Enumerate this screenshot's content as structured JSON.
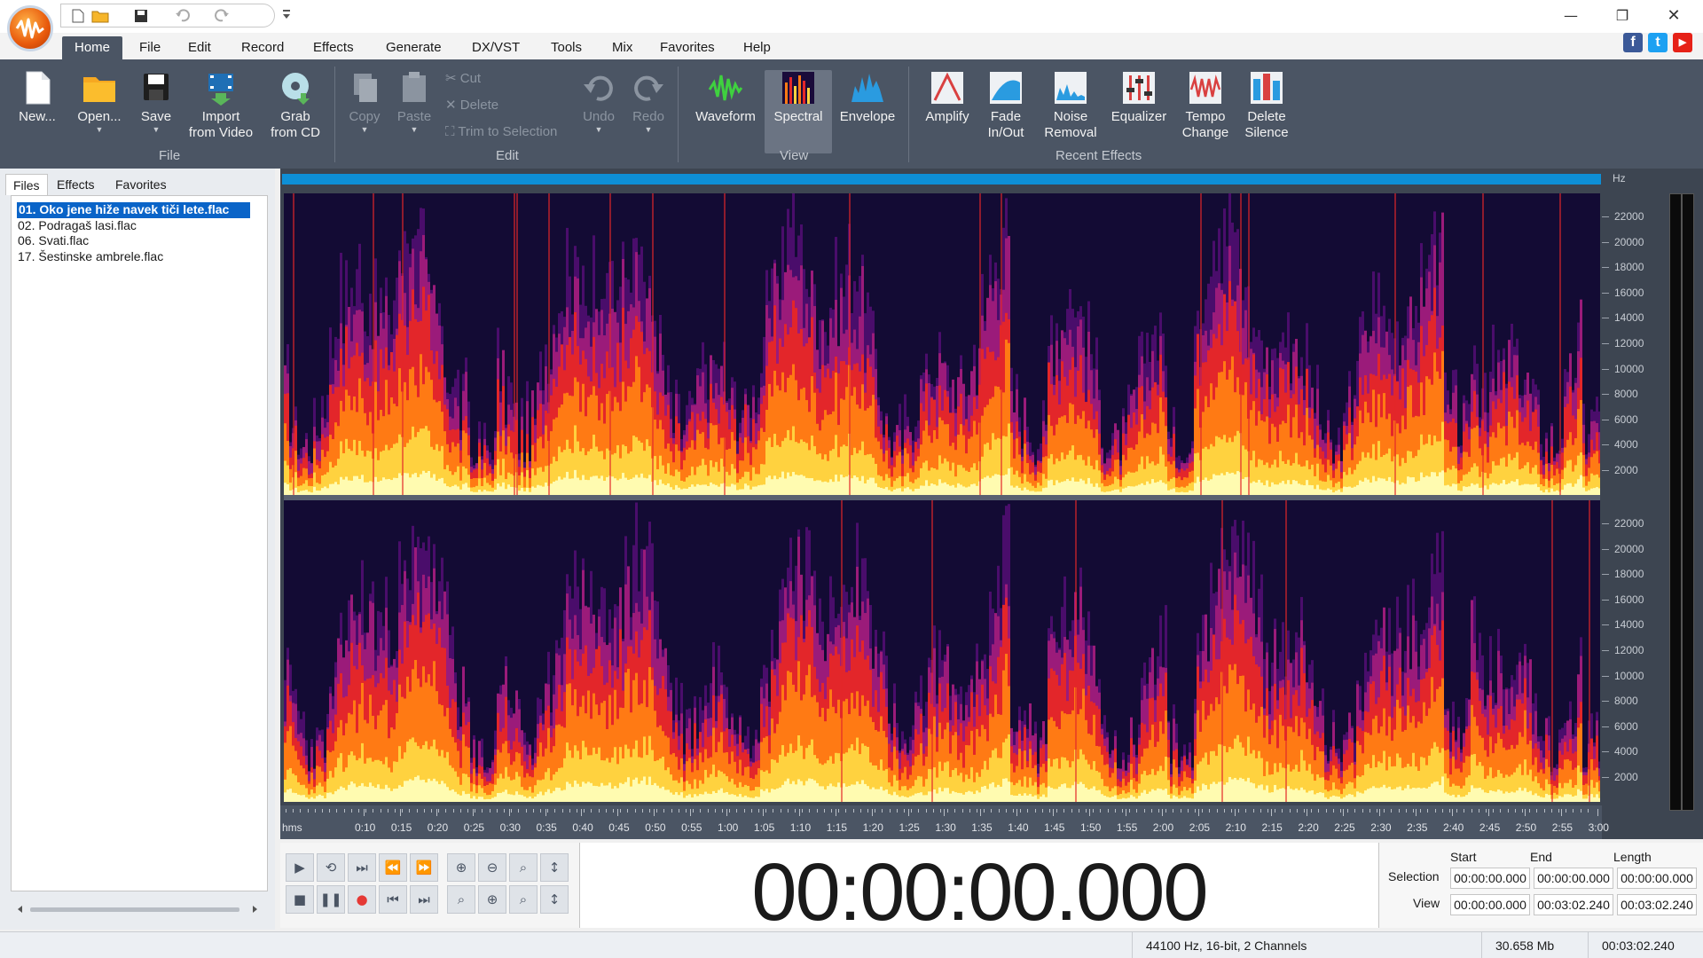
{
  "quick_access": {
    "icons": [
      "new-icon",
      "open-folder-icon",
      "save-icon",
      "undo-icon",
      "redo-icon",
      "customize-icon"
    ]
  },
  "window_controls": {
    "minimize": "—",
    "maximize": "❐",
    "close": "✕"
  },
  "menu": {
    "tabs": [
      "Home",
      "File",
      "Edit",
      "Record",
      "Effects",
      "Generate",
      "DX/VST",
      "Tools",
      "Mix",
      "Favorites",
      "Help"
    ],
    "active": "Home"
  },
  "social": {
    "facebook": {
      "label": "f",
      "color": "#3b5998"
    },
    "twitter": {
      "label": "t",
      "color": "#1da1f2"
    },
    "youtube": {
      "label": "▶",
      "color": "#e62117"
    }
  },
  "ribbon": {
    "file_group": {
      "label": "File",
      "new": "New...",
      "open": "Open...",
      "save": "Save",
      "import": [
        "Import",
        "from Video"
      ],
      "grab": [
        "Grab",
        "from CD"
      ]
    },
    "edit_group": {
      "label": "Edit",
      "copy": "Copy",
      "paste": "Paste",
      "cut": "Cut",
      "delete": "Delete",
      "trim": "Trim to Selection",
      "undo": "Undo",
      "redo": "Redo"
    },
    "view_group": {
      "label": "View",
      "waveform": "Waveform",
      "spectral": "Spectral",
      "envelope": "Envelope",
      "active": "Spectral"
    },
    "effects_group": {
      "label": "Recent Effects",
      "amplify": "Amplify",
      "fade": [
        "Fade",
        "In/Out"
      ],
      "noise": [
        "Noise",
        "Removal"
      ],
      "equalizer": "Equalizer",
      "tempo": [
        "Tempo",
        "Change"
      ],
      "silence": [
        "Delete",
        "Silence"
      ]
    }
  },
  "left_panel": {
    "tabs": [
      "Files",
      "Effects",
      "Favorites"
    ],
    "active_tab": "Files",
    "files": [
      "01. Oko jene hiže navek tiči lete.flac",
      "02. Podragaš lasi.flac",
      "06. Svati.flac",
      "17. Šestinske ambrele.flac"
    ],
    "selected_index": 0
  },
  "editor": {
    "view_mode": "Spectral",
    "channels": 2,
    "hz_unit": "Hz",
    "hz_ticks": [
      "22000",
      "20000",
      "18000",
      "16000",
      "14000",
      "12000",
      "10000",
      "8000",
      "6000",
      "4000",
      "2000"
    ],
    "time_unit": "hms",
    "time_labels": [
      "0:10",
      "0:15",
      "0:20",
      "0:25",
      "0:30",
      "0:35",
      "0:40",
      "0:45",
      "0:50",
      "0:55",
      "1:00",
      "1:05",
      "1:10",
      "1:15",
      "1:20",
      "1:25",
      "1:30",
      "1:35",
      "1:40",
      "1:45",
      "1:50",
      "1:55",
      "2:00",
      "2:05",
      "2:10",
      "2:15",
      "2:20",
      "2:25",
      "2:30",
      "2:35",
      "2:40",
      "2:45",
      "2:50",
      "2:55",
      "3:00"
    ],
    "palette": [
      "#130b34",
      "#4a0d6b",
      "#9b1b7a",
      "#e3262a",
      "#ff7a14",
      "#ffd23f",
      "#fffbb0"
    ]
  },
  "transport": {
    "row1": [
      "play-icon",
      "play-loop-icon",
      "play-to-end-icon",
      "rewind-icon",
      "fast-forward-icon"
    ],
    "row2": [
      "stop-icon",
      "pause-icon",
      "record-icon",
      "go-to-start-icon",
      "go-to-end-icon"
    ],
    "zoom_row1": [
      "zoom-in-icon",
      "zoom-out-icon",
      "zoom-full-icon",
      "zoom-vertical-in-icon"
    ],
    "zoom_row2": [
      "zoom-selection-icon",
      "zoom-center-icon",
      "zoom-fit-icon",
      "zoom-vertical-out-icon"
    ],
    "record_color": "#e53935"
  },
  "time_display": "00:00:00.000",
  "selection_panel": {
    "headers": [
      "Start",
      "End",
      "Length"
    ],
    "rows": [
      {
        "label": "Selection",
        "start": "00:00:00.000",
        "end": "00:00:00.000",
        "length": "00:00:00.000"
      },
      {
        "label": "View",
        "start": "00:00:00.000",
        "end": "00:03:02.240",
        "length": "00:03:02.240"
      }
    ]
  },
  "status_bar": {
    "format": "44100 Hz, 16-bit, 2 Channels",
    "size": "30.658 Mb",
    "duration": "00:03:02.240"
  }
}
